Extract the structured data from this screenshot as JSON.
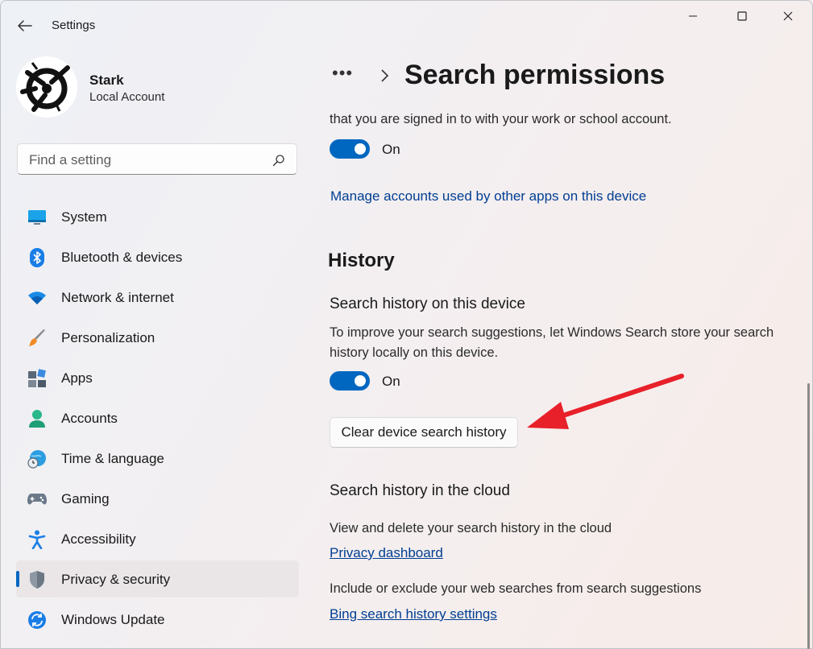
{
  "window": {
    "title": "Settings"
  },
  "profile": {
    "name": "Stark",
    "account_type": "Local Account"
  },
  "search": {
    "placeholder": "Find a setting"
  },
  "nav": {
    "items": [
      {
        "label": "System",
        "icon": "monitor-icon"
      },
      {
        "label": "Bluetooth & devices",
        "icon": "bluetooth-icon"
      },
      {
        "label": "Network & internet",
        "icon": "wifi-icon"
      },
      {
        "label": "Personalization",
        "icon": "paintbrush-icon"
      },
      {
        "label": "Apps",
        "icon": "apps-icon"
      },
      {
        "label": "Accounts",
        "icon": "person-icon"
      },
      {
        "label": "Time & language",
        "icon": "globe-clock-icon"
      },
      {
        "label": "Gaming",
        "icon": "gamepad-icon"
      },
      {
        "label": "Accessibility",
        "icon": "accessibility-icon"
      },
      {
        "label": "Privacy & security",
        "icon": "shield-icon",
        "selected": true
      },
      {
        "label": "Windows Update",
        "icon": "update-icon"
      }
    ]
  },
  "breadcrumb": {
    "ellipsis": "•••",
    "current": "Search permissions"
  },
  "main": {
    "cloud_content": {
      "desc_tail": "that you are signed in to with your work or school account.",
      "toggle_state": "On",
      "link": "Manage accounts used by other apps on this device"
    },
    "history": {
      "section_title": "History",
      "device": {
        "title": "Search history on this device",
        "desc": "To improve your search suggestions, let Windows Search store your search history locally on this device.",
        "toggle_state": "On",
        "clear_button": "Clear device search history"
      },
      "cloud": {
        "title": "Search history in the cloud",
        "view_desc": "View and delete your search history in the cloud",
        "privacy_link": "Privacy dashboard",
        "web_desc": "Include or exclude your web searches from search suggestions",
        "bing_link": "Bing search history settings"
      }
    }
  },
  "colors": {
    "accent": "#0067c0",
    "link": "#003e92",
    "annotation_arrow": "#e8202a"
  }
}
